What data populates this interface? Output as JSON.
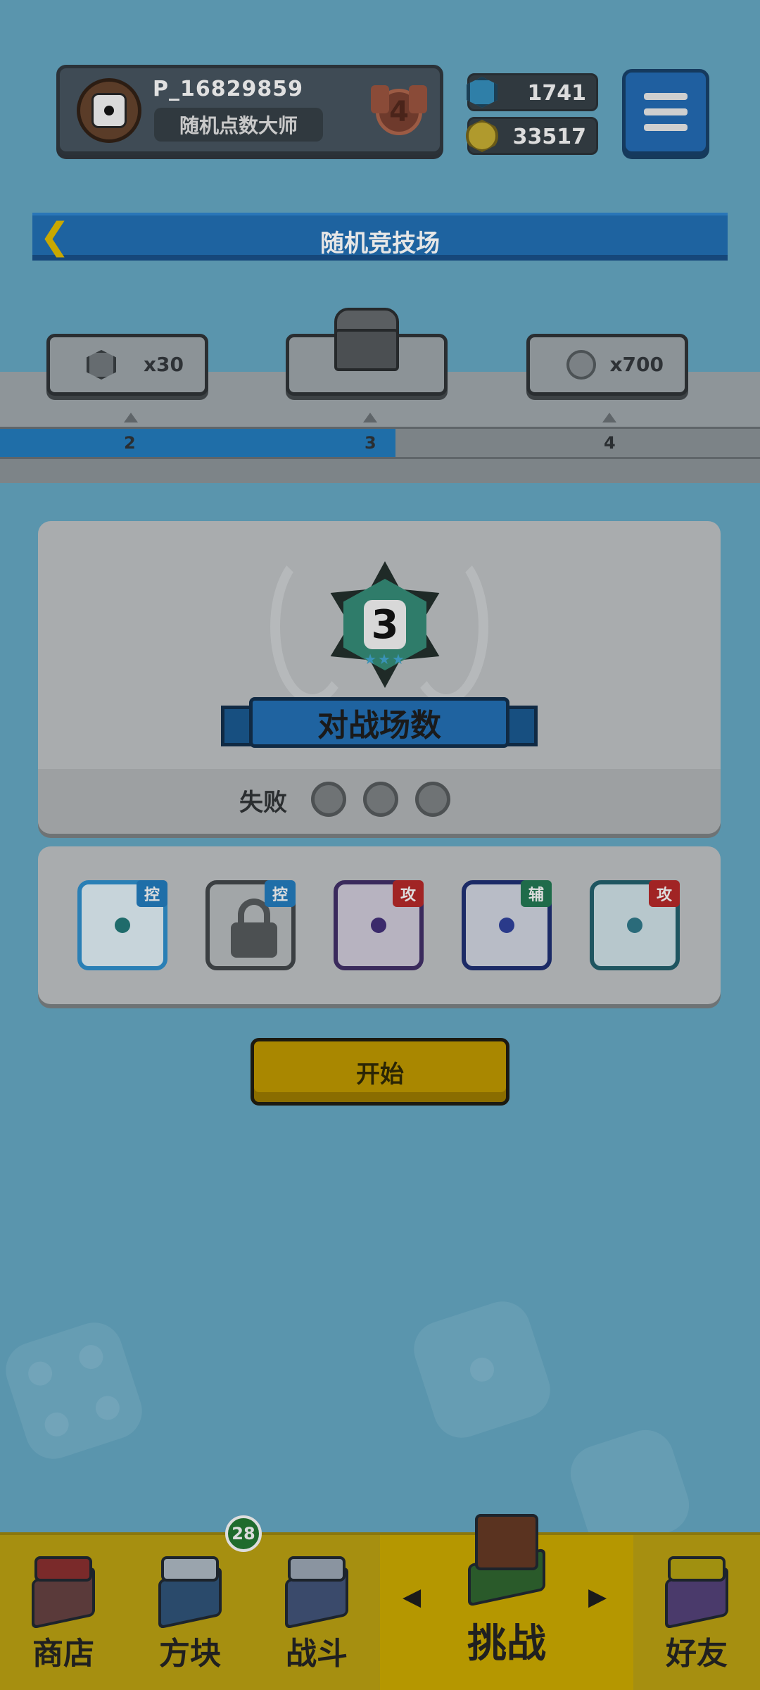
{
  "header": {
    "player_name": "P_16829859",
    "player_title": "随机点数大师",
    "rank": "4",
    "gems": "1741",
    "coins": "33517"
  },
  "icons": {
    "avatar": "die-avatar-icon",
    "gem": "blue-gem-icon",
    "coin": "gold-coin-icon",
    "menu": "hamburger-menu-icon",
    "back": "back-arrow-icon"
  },
  "banner": {
    "title": "随机竞技场"
  },
  "track": {
    "rewards": [
      {
        "amount": "x30",
        "icon": "silver-gem-icon"
      },
      {
        "amount": "",
        "icon": "treasure-chest-icon"
      },
      {
        "amount": "x700",
        "icon": "silver-coin-icon"
      }
    ],
    "stages": [
      "2",
      "3",
      "4"
    ],
    "progress": 0.52
  },
  "battle": {
    "count": "3",
    "label": "对战场数",
    "loss_label": "失败",
    "losses_total": 3,
    "losses_used": 0
  },
  "deck": [
    {
      "tag": "控",
      "tag_color": "#1f6ea8"
    },
    {
      "tag": "控",
      "tag_color": "#1f6ea8"
    },
    {
      "tag": "攻",
      "tag_color": "#a12424"
    },
    {
      "tag": "辅",
      "tag_color": "#1f6b4a"
    },
    {
      "tag": "攻",
      "tag_color": "#a12424"
    }
  ],
  "start_button": "开始",
  "nav": {
    "items": [
      "商店",
      "方块",
      "战斗",
      "挑战",
      "好友"
    ],
    "active": "挑战",
    "badge": "28"
  },
  "colors": {
    "background": "#5a95ad",
    "accent_blue": "#1f63a0",
    "accent_yellow": "#a98700"
  }
}
